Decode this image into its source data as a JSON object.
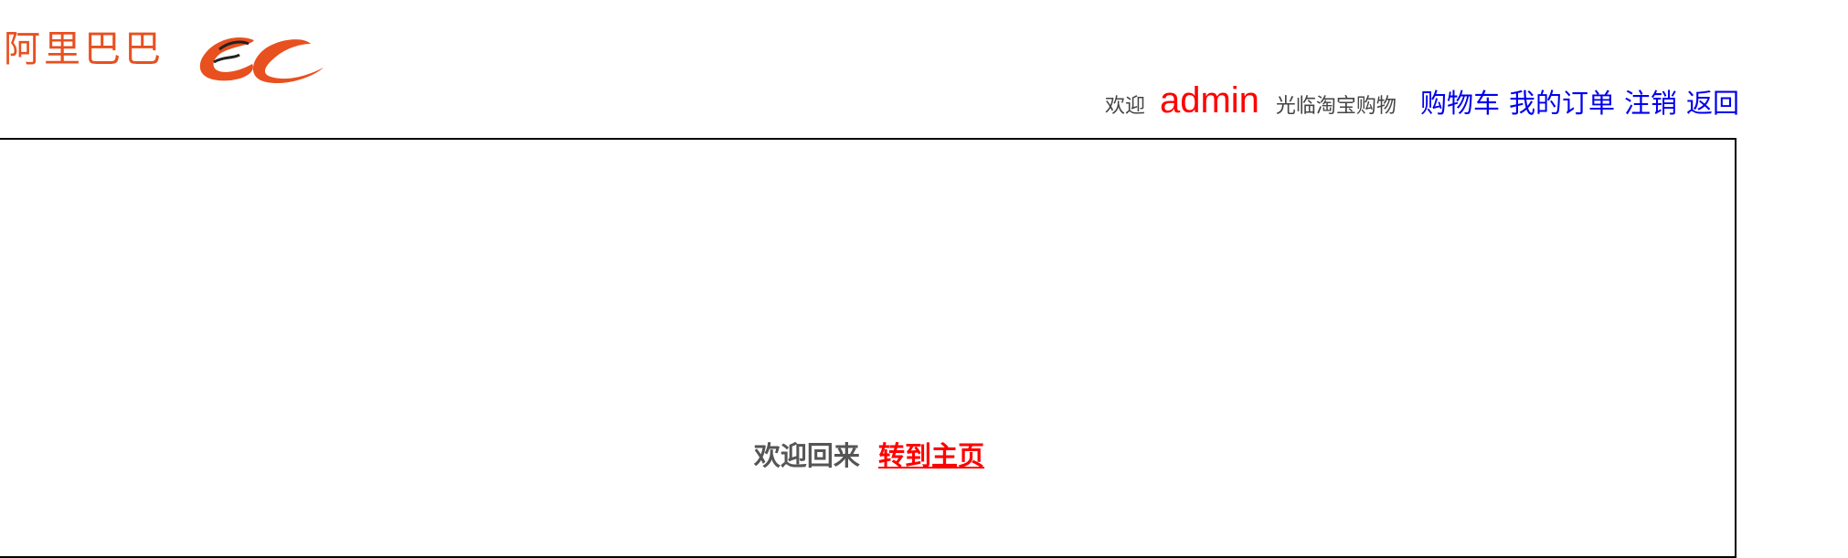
{
  "logo": {
    "text": "阿里巴巴",
    "mark_icon": "alibaba-smile-logo",
    "brand_color": "#e8501f"
  },
  "header": {
    "welcome_prefix": "欢迎",
    "username": "admin",
    "welcome_suffix": "光临淘宝购物",
    "links": {
      "cart": "购物车",
      "orders": "我的订单",
      "logout": "注销",
      "back": "返回"
    }
  },
  "main": {
    "welcome_back": "欢迎回来",
    "home_link": "转到主页"
  },
  "colors": {
    "username": "#ff0000",
    "nav_link": "#0000ee",
    "home_link": "#ff0000",
    "border": "#000000"
  }
}
